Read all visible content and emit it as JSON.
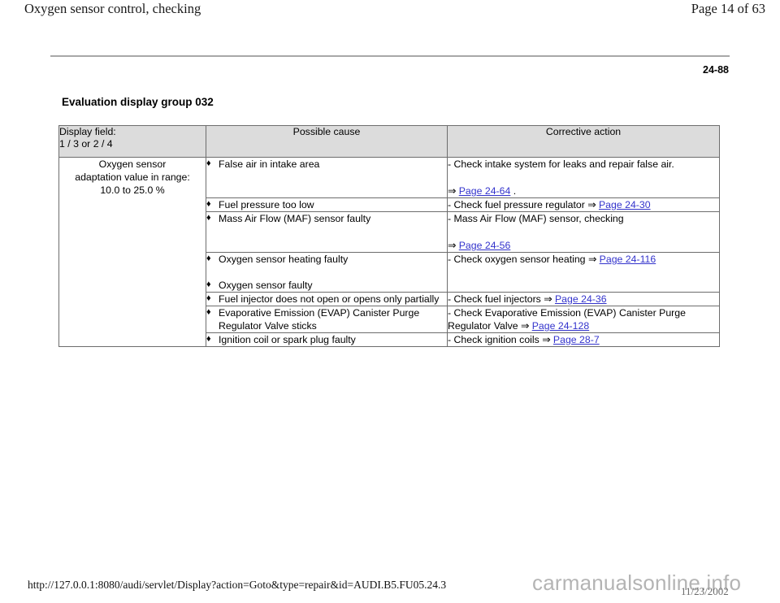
{
  "header": {
    "doc_title": "Oxygen sensor control, checking",
    "page_label": "Page 14 of 63"
  },
  "section": {
    "id": "24-88",
    "heading": "Evaluation display group 032"
  },
  "table": {
    "columns": [
      {
        "line1": "Display field:",
        "line2": "1 / 3 or 2 / 4"
      },
      {
        "label": "Possible cause"
      },
      {
        "label": "Corrective action"
      }
    ],
    "display_field": {
      "line1": "Oxygen sensor",
      "line2": "adaptation value in range:",
      "line3": "10.0 to 25.0 %"
    },
    "bullet_glyph": "♦",
    "arrow_glyph": "⇒",
    "rows": [
      {
        "causes": [
          "False air in intake area"
        ],
        "action": {
          "text": "- Check intake system for leaks and repair false air.",
          "link_prefix": "",
          "link": "Page 24-64",
          "link_suffix": " .",
          "link_on_new_line": true
        }
      },
      {
        "causes": [
          "Fuel pressure too low"
        ],
        "action": {
          "text": "- Check fuel pressure regulator",
          "link_prefix": "",
          "link": "Page 24-30",
          "link_suffix": "",
          "link_on_new_line": false
        }
      },
      {
        "causes": [
          "Mass Air Flow (MAF) sensor faulty"
        ],
        "action": {
          "text": "- Mass Air Flow (MAF) sensor, checking",
          "link_prefix": "",
          "link": "Page 24-56",
          "link_suffix": "",
          "link_on_new_line": true
        }
      },
      {
        "causes": [
          "Oxygen sensor heating faulty",
          "Oxygen sensor faulty"
        ],
        "action": {
          "text": "- Check oxygen sensor heating",
          "link_prefix": "",
          "link": "Page 24-116",
          "link_suffix": "",
          "link_on_new_line": false
        }
      },
      {
        "causes": [
          "Fuel injector does not open or opens only partially"
        ],
        "action": {
          "text": "- Check fuel injectors",
          "link_prefix": "",
          "link": "Page 24-36",
          "link_suffix": "",
          "link_on_new_line": false
        }
      },
      {
        "causes": [
          "Evaporative Emission (EVAP) Canister Purge Regulator Valve sticks"
        ],
        "action": {
          "text": "- Check Evaporative Emission (EVAP) Canister Purge Regulator Valve",
          "link_prefix": "",
          "link": "Page 24-128",
          "link_suffix": "",
          "link_on_new_line": false
        }
      },
      {
        "causes": [
          "Ignition coil or spark plug faulty"
        ],
        "action": {
          "text": "- Check ignition coils",
          "link_prefix": "",
          "link": "Page 28-7",
          "link_suffix": "",
          "link_on_new_line": false
        }
      }
    ]
  },
  "footer": {
    "url": "http://127.0.0.1:8080/audi/servlet/Display?action=Goto&type=repair&id=AUDI.B5.FU05.24.3",
    "watermark": "carmanualsonline.info",
    "date": "11/23/2002"
  },
  "colors": {
    "link": "#3333cc",
    "header_bg": "#dcdcdc",
    "border": "#6d6d6d",
    "watermark": "#b4b4b4"
  }
}
